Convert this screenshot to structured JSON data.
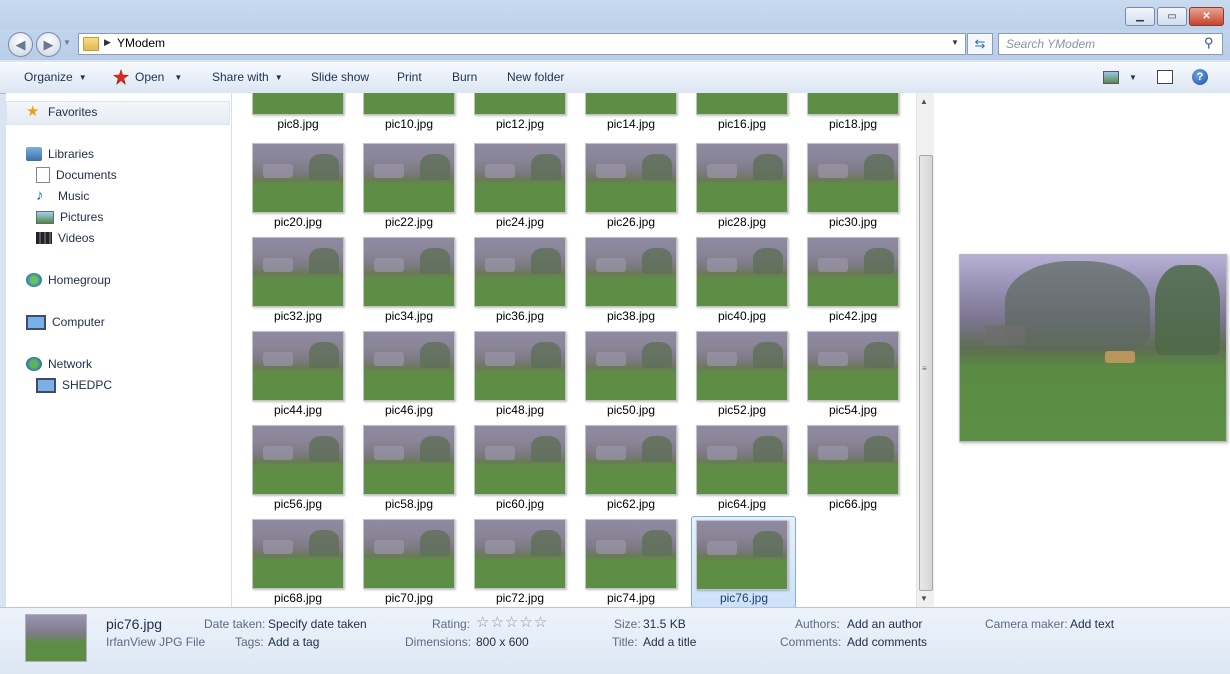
{
  "window": {
    "title": ""
  },
  "address": {
    "path": "YModem",
    "search_placeholder": "Search YModem"
  },
  "toolbar": {
    "organize": "Organize",
    "open": "Open",
    "share_with": "Share with",
    "slide_show": "Slide show",
    "print": "Print",
    "burn": "Burn",
    "new_folder": "New folder"
  },
  "nav": {
    "favorites": "Favorites",
    "libraries": "Libraries",
    "documents": "Documents",
    "music": "Music",
    "pictures": "Pictures",
    "videos": "Videos",
    "homegroup": "Homegroup",
    "computer": "Computer",
    "network": "Network",
    "shedpc": "SHEDPC"
  },
  "files": {
    "row0": [
      "pic8.jpg",
      "pic10.jpg",
      "pic12.jpg",
      "pic14.jpg",
      "pic16.jpg",
      "pic18.jpg"
    ],
    "row1": [
      "pic20.jpg",
      "pic22.jpg",
      "pic24.jpg",
      "pic26.jpg",
      "pic28.jpg",
      "pic30.jpg"
    ],
    "row2": [
      "pic32.jpg",
      "pic34.jpg",
      "pic36.jpg",
      "pic38.jpg",
      "pic40.jpg",
      "pic42.jpg"
    ],
    "row3": [
      "pic44.jpg",
      "pic46.jpg",
      "pic48.jpg",
      "pic50.jpg",
      "pic52.jpg",
      "pic54.jpg"
    ],
    "row4": [
      "pic56.jpg",
      "pic58.jpg",
      "pic60.jpg",
      "pic62.jpg",
      "pic64.jpg",
      "pic66.jpg"
    ],
    "row5": [
      "pic68.jpg",
      "pic70.jpg",
      "pic72.jpg",
      "pic74.jpg",
      "pic76.jpg"
    ]
  },
  "selected_file": "pic76.jpg",
  "details": {
    "filename": "pic76.jpg",
    "filetype": "IrfanView JPG File",
    "date_taken_label": "Date taken:",
    "date_taken_value": "Specify date taken",
    "tags_label": "Tags:",
    "tags_value": "Add a tag",
    "rating_label": "Rating:",
    "rating_stars": "☆☆☆☆☆",
    "dimensions_label": "Dimensions:",
    "dimensions_value": "800 x 600",
    "size_label": "Size:",
    "size_value": "31.5 KB",
    "title_label": "Title:",
    "title_value": "Add a title",
    "authors_label": "Authors:",
    "authors_value": "Add an author",
    "comments_label": "Comments:",
    "comments_value": "Add comments",
    "camera_label": "Camera maker:",
    "camera_value": "Add text"
  },
  "icons": {
    "back": "back-arrow-icon",
    "forward": "forward-arrow-icon",
    "folder": "folder-icon",
    "refresh": "refresh-icon",
    "search": "search-icon",
    "help": "help-icon"
  }
}
